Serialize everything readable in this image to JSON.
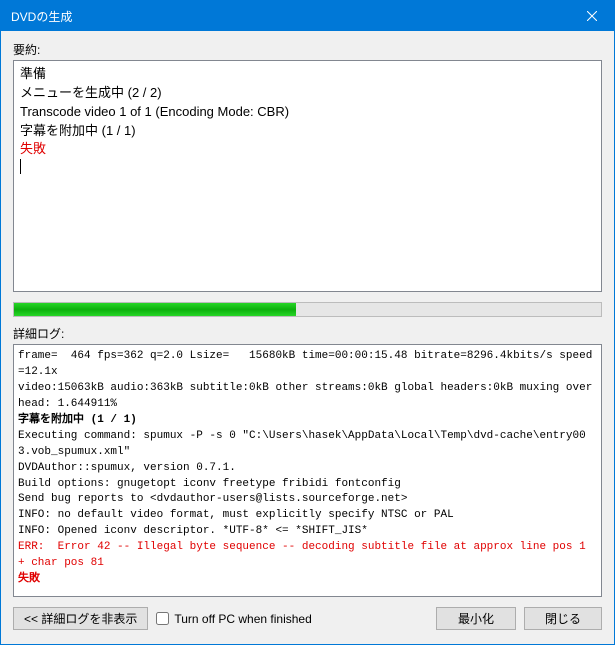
{
  "window": {
    "title": "DVDの生成"
  },
  "summary": {
    "label": "要約:",
    "lines": [
      {
        "text": "準備",
        "error": false
      },
      {
        "text": "メニューを生成中 (2 / 2)",
        "error": false
      },
      {
        "text": "Transcode video 1 of 1 (Encoding Mode: CBR)",
        "error": false
      },
      {
        "text": "字幕を附加中 (1 / 1)",
        "error": false
      },
      {
        "text": "失敗",
        "error": true
      }
    ]
  },
  "progress": {
    "percent": 48
  },
  "log": {
    "label": "詳細ログ:",
    "lines": [
      {
        "text": "frame=  464 fps=362 q=2.0 Lsize=   15680kB time=00:00:15.48 bitrate=8296.4kbits/s speed=12.1x",
        "error": false
      },
      {
        "text": "video:15063kB audio:363kB subtitle:0kB other streams:0kB global headers:0kB muxing overhead: 1.644911%",
        "error": false
      },
      {
        "text": "字幕を附加中 (1 / 1)",
        "error": false,
        "bold": true
      },
      {
        "text": "Executing command: spumux -P -s 0 \"C:\\Users\\hasek\\AppData\\Local\\Temp\\dvd-cache\\entry003.vob_spumux.xml\"",
        "error": false
      },
      {
        "text": "DVDAuthor::spumux, version 0.7.1.",
        "error": false
      },
      {
        "text": "Build options: gnugetopt iconv freetype fribidi fontconfig",
        "error": false
      },
      {
        "text": "Send bug reports to <dvdauthor-users@lists.sourceforge.net>",
        "error": false
      },
      {
        "text": "INFO: no default video format, must explicitly specify NTSC or PAL",
        "error": false
      },
      {
        "text": "INFO: Opened iconv descriptor. *UTF-8* <= *SHIFT_JIS*",
        "error": false
      },
      {
        "text": "ERR:  Error 42 -- Illegal byte sequence -- decoding subtitle file at approx line pos 1 + char pos 81",
        "error": true
      },
      {
        "text": "失敗",
        "error": true,
        "bold": true
      }
    ]
  },
  "footer": {
    "hide_log_label": "<< 詳細ログを非表示",
    "checkbox_label": "Turn off PC when finished",
    "checkbox_checked": false,
    "minimize_label": "最小化",
    "close_label": "閉じる"
  }
}
